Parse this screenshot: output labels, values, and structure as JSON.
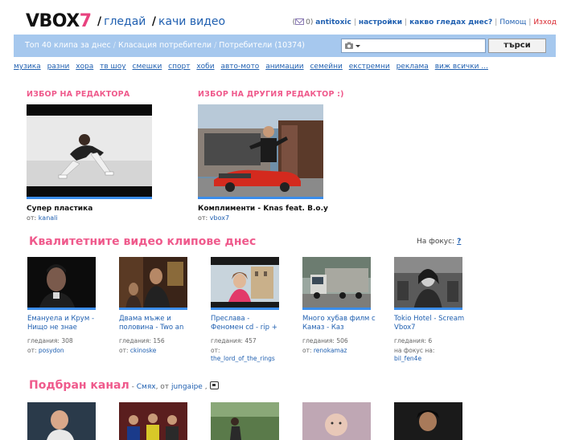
{
  "header": {
    "logo_main": "VBOX",
    "logo_accent": "7",
    "nav_watch": "гледай",
    "nav_upload": "качи видео",
    "mail_count": "0)",
    "username": "antitoxic",
    "settings": "настройки",
    "what_watching": "какво гледах днес?",
    "help": "Помощ",
    "logout": "Изход"
  },
  "toolbar": {
    "tabs": [
      "Топ 40 клипа за днес",
      "Класация потребители",
      "Потребители (10374)"
    ],
    "search_placeholder": "",
    "search_button": "търси"
  },
  "categories": [
    "музика",
    "разни",
    "хора",
    "тв шоу",
    "смешки",
    "спорт",
    "хоби",
    "авто-мото",
    "анимации",
    "семейни",
    "екстремни",
    "реклама",
    "виж всички ..."
  ],
  "editor_picks": [
    {
      "heading": "ИЗБОР НА РЕДАКТОРА",
      "title": "Супер пластика",
      "from_label": "от:",
      "author": "kanali"
    },
    {
      "heading": "ИЗБОР НА ДРУГИЯ РЕДАКТОР :)",
      "title": "Комплименти - Knas feat. B.o.y",
      "from_label": "от:",
      "author": "vbox7"
    }
  ],
  "quality": {
    "title": "Квалитетните видео клипове днес",
    "focus_label": "На фокус:",
    "focus_link": "?",
    "videos": [
      {
        "title_1": "Емануела и Крум -",
        "title_2": "Нищо не знае",
        "views": "гледания: 308",
        "from_label": "от:",
        "author": "posydon"
      },
      {
        "title_1": "Двама мъже и",
        "title_2": "половина - Two an",
        "views": "гледания: 156",
        "from_label": "от:",
        "author": "ckinoske"
      },
      {
        "title_1": "Преслава -",
        "title_2": "Феномен cd - rip +",
        "views": "гледания: 457",
        "from_label": "от:",
        "author": "the_lord_of_the_rings"
      },
      {
        "title_1": "Много хубав филм с",
        "title_2": "Камаз - Каз",
        "views": "гледания: 506",
        "from_label": "от:",
        "author": "renokamaz"
      },
      {
        "title_1": "Tokio Hotel - Scream",
        "title_2": "Vbox7",
        "views": "гледания: 6",
        "from_label": "на фокус на:",
        "author": "bil_fen4e"
      }
    ]
  },
  "channel": {
    "title": "Подбран канал",
    "separator": " - ",
    "name": "Смях",
    "from_label": ", от",
    "author": "jungaipe",
    "trail": " ,"
  },
  "colors": {
    "accent_pink": "#ef5a8c",
    "link_blue": "#1f5fb0",
    "bar_blue": "#a6c8ee",
    "thumb_border": "#3b8dea"
  }
}
